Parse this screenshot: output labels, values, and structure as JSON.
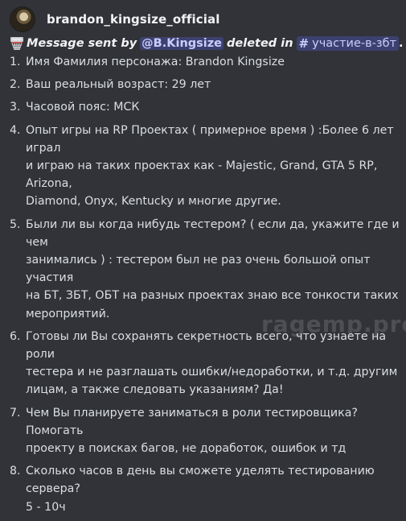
{
  "author": {
    "username": "brandon_kingsize_official"
  },
  "system_message": {
    "icon": "basketball-hoop-icon",
    "prefix": "Message sent by",
    "mention": "@B.Kingsize",
    "middle": "deleted in",
    "channel_icon": "#",
    "channel": "участие-в-збт",
    "end": "."
  },
  "items": [
    {
      "num": "1.",
      "text": "Имя Фамилия персонажа: Brandon Kingsize"
    },
    {
      "num": "2.",
      "text": "Ваш реальный возраст: 29 лет"
    },
    {
      "num": "3.",
      "text": "Часовой пояс: МСК"
    },
    {
      "num": "4.",
      "text": "Опыт игры на RP Проектах ( примерное время ) :Более 6 лет играл\nи играю на таких проектах как -  Majestic, Grand, GTA 5 RP, Arizona,\nDiamond, Onyx, Kentucky и многие другие."
    },
    {
      "num": "5.",
      "text": "Были ли вы когда нибудь тестером? ( если да, укажите где и чем\nзанимались ) : тестером был не раз очень большой опыт участия\nна БТ, ЗБТ, ОБТ на разных проектах знаю все тонкости таких\nмероприятий."
    },
    {
      "num": "6.",
      "text": "Готовы ли Вы сохранять секретность всего, что узнаете на роли\nтестера и не разглашать ошибки/недоработки, и т.д. другим\nлицам, а также следовать указаниям? Да!"
    },
    {
      "num": "7.",
      "text": "Чем Вы планируете заниматься в роли тестировщика? Помогать\nпроекту в поисках багов, не доработок, ошибок и тд"
    },
    {
      "num": "8.",
      "text": "Сколько часов в день вы сможете уделять тестированию сервера?\n5 - 10ч"
    }
  ],
  "watermark": "ragemp.pro"
}
